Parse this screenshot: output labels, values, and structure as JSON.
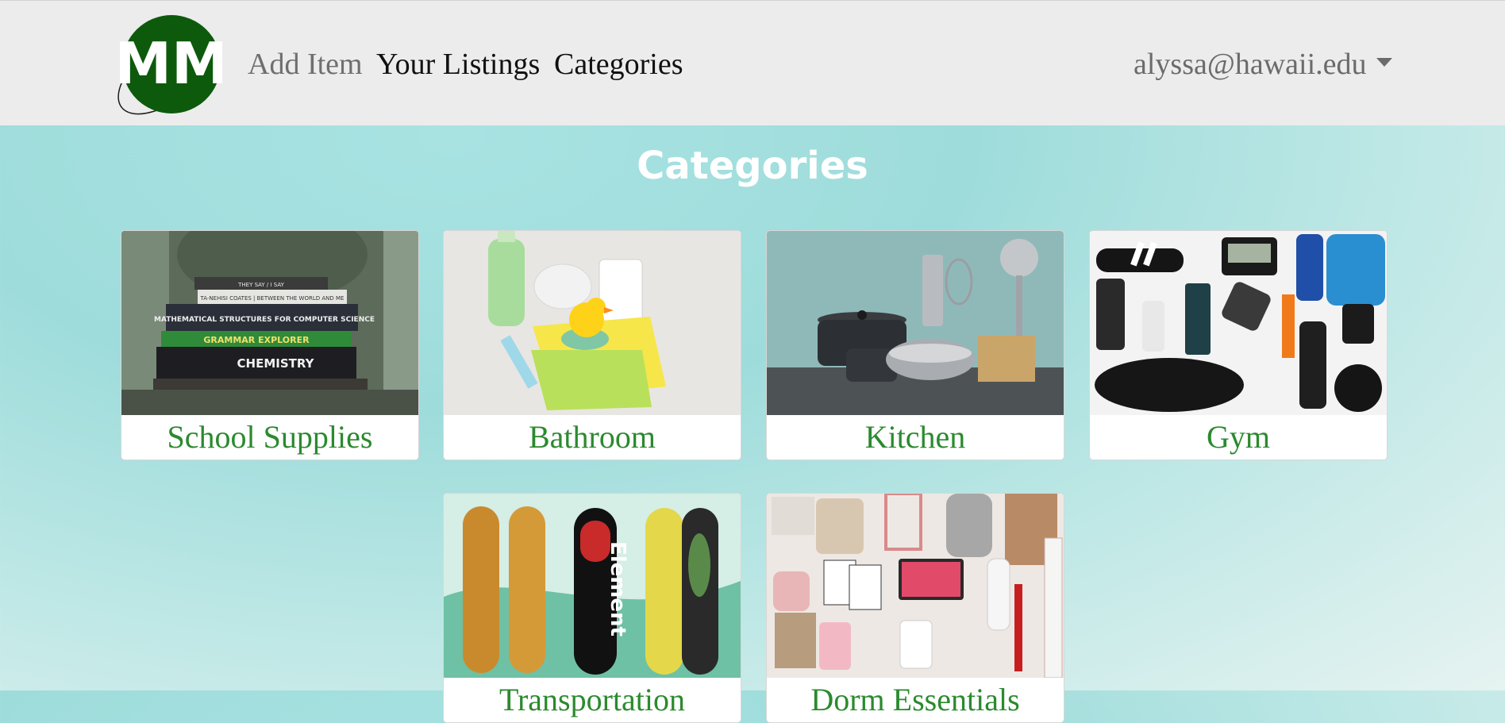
{
  "nav": {
    "logo_text": "MM",
    "add_item": "Add Item",
    "your_listings": "Your Listings",
    "categories": "Categories",
    "user_email": "alyssa@hawaii.edu"
  },
  "page": {
    "title": "Categories"
  },
  "categories": [
    {
      "label": "School Supplies"
    },
    {
      "label": "Bathroom"
    },
    {
      "label": "Kitchen"
    },
    {
      "label": "Gym"
    },
    {
      "label": "Transportation"
    },
    {
      "label": "Dorm Essentials"
    }
  ],
  "book_titles": [
    "THEY SAY / I SAY",
    "TA-NEHISI COATES | BETWEEN THE WORLD AND ME",
    "MATHEMATICAL STRUCTURES FOR COMPUTER SCIENCE",
    "GRAMMAR EXPLORER",
    "CHEMISTRY"
  ],
  "skate_brand": "Element",
  "colors": {
    "navbar_bg": "#ececec",
    "label_green": "#2b8a2e",
    "title_white": "#ffffff",
    "logo_green": "#0d5a0d"
  }
}
